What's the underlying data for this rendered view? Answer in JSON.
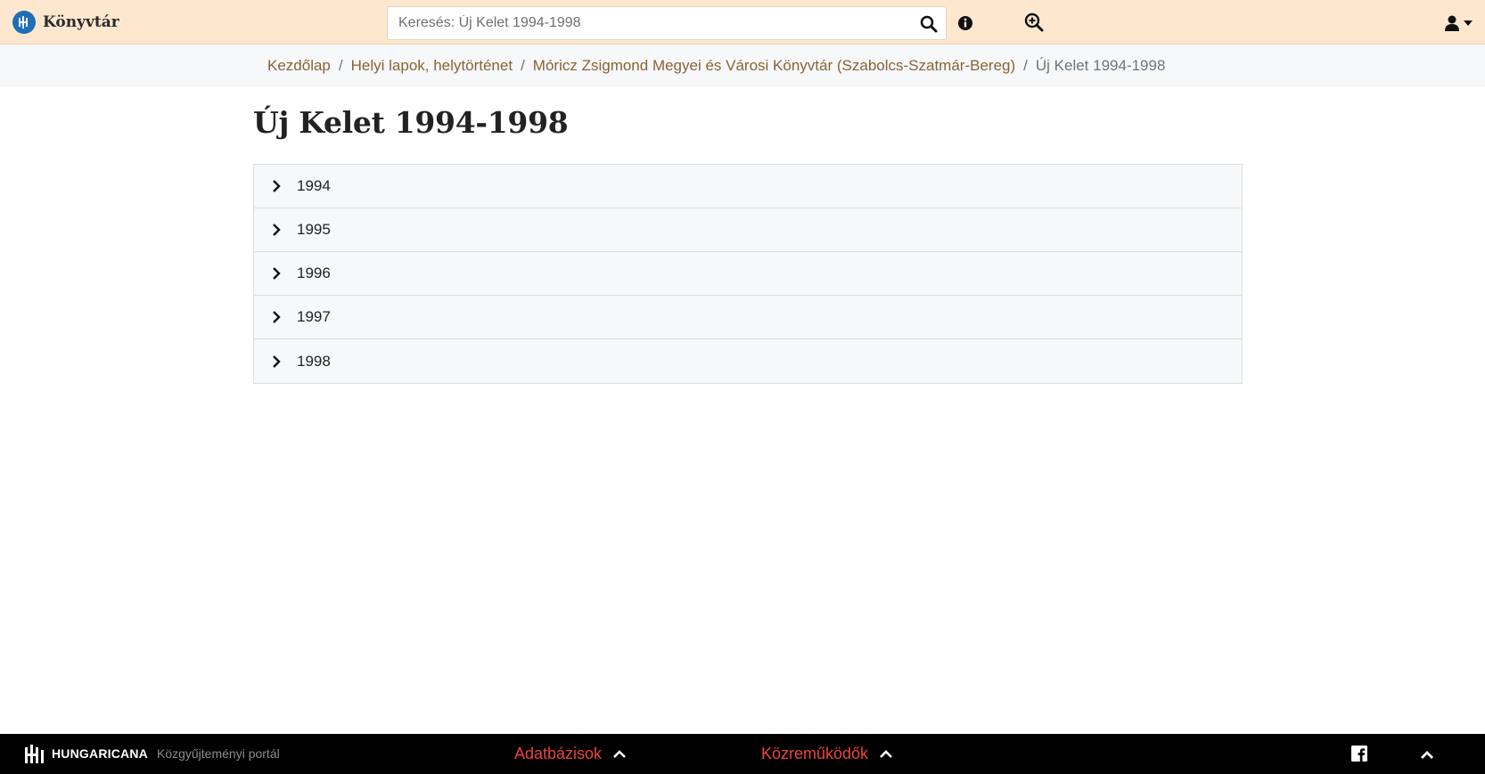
{
  "header": {
    "brand_name": "Könyvtár",
    "search_placeholder": "Keresés: Új Kelet 1994-1998",
    "search_value": ""
  },
  "breadcrumb": {
    "items": [
      "Kezdőlap",
      "Helyi lapok, helytörténet",
      "Móricz Zsigmond Megyei és Városi Könyvtár (Szabolcs-Szatmár-Bereg)"
    ],
    "current": "Új Kelet 1994-1998",
    "separator": "/"
  },
  "main": {
    "title": "Új Kelet 1994-1998",
    "years": [
      "1994",
      "1995",
      "1996",
      "1997",
      "1998"
    ]
  },
  "footer": {
    "brand_name": "HUNGARICANA",
    "brand_sub": "Közgyűjteményi portál",
    "links": [
      "Adatbázisok",
      "Közreműködők"
    ]
  },
  "colors": {
    "topbar_bg": "#fde8cf",
    "link": "#8a6234",
    "footer_link": "#e8453c",
    "brand_blue": "#1f6fb5"
  },
  "icons": [
    "logo-icon",
    "search-icon",
    "info-icon",
    "zoom-in-icon",
    "user-icon",
    "caret-down-icon",
    "chevron-right-icon",
    "facebook-icon",
    "chevron-up-icon"
  ]
}
